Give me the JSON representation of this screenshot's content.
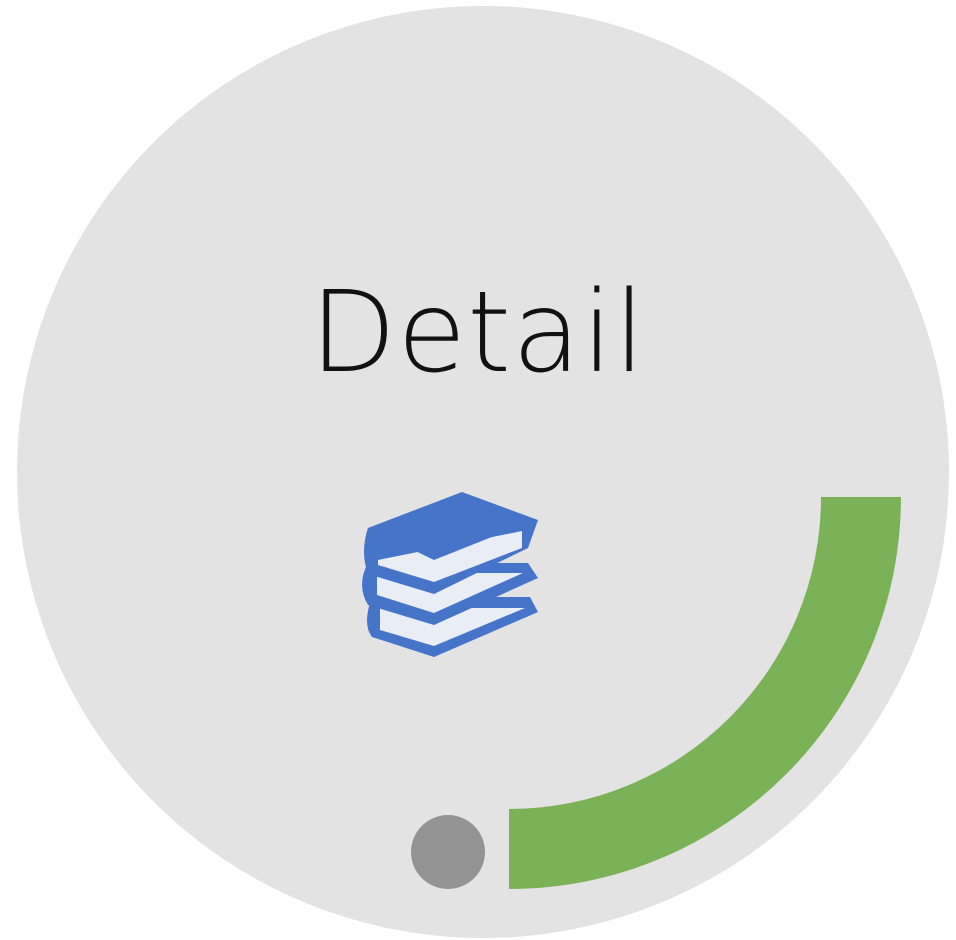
{
  "widget": {
    "title": "Detail",
    "icon": "books-stack-icon",
    "progress_fraction": 0.25,
    "colors": {
      "background": "#e3e3e3",
      "progress": "#7cb257",
      "indicator": "#939393",
      "icon": "#4674c9",
      "icon_pages": "#e9edf6"
    }
  }
}
